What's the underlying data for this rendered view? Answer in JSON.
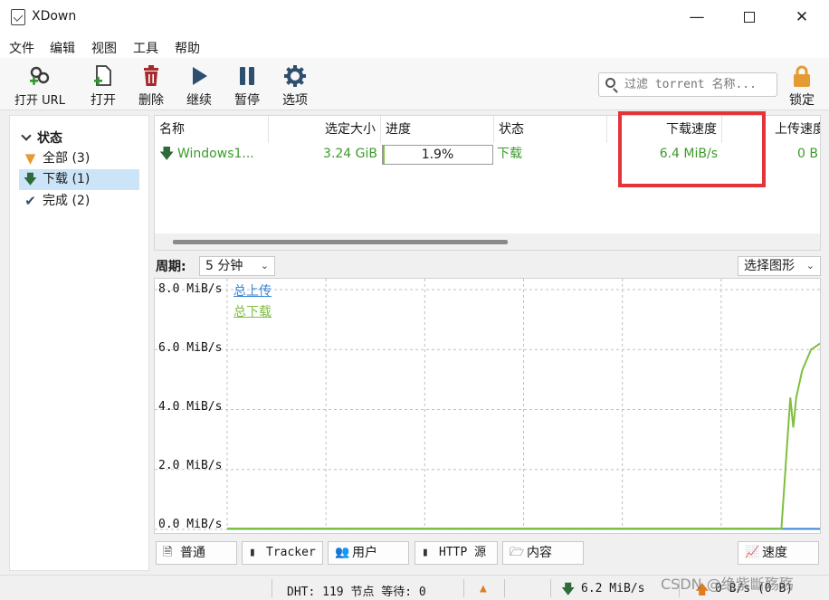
{
  "window": {
    "title": "XDown",
    "minimize_icon": "minimize-icon",
    "maximize_icon": "maximize-icon",
    "close_icon": "close-icon"
  },
  "menu": [
    "文件",
    "编辑",
    "视图",
    "工具",
    "帮助"
  ],
  "toolbar": {
    "open_url": "打开 URL",
    "open": "打开",
    "delete": "删除",
    "resume": "继续",
    "pause": "暂停",
    "options": "选项",
    "filter_placeholder": "过滤 torrent 名称...",
    "lock": "锁定"
  },
  "sidebar": {
    "header": "状态",
    "items": [
      {
        "label": "全部 (3)",
        "icon": "funnel-icon",
        "active": false
      },
      {
        "label": "下载 (1)",
        "icon": "download-arrow-icon",
        "active": true
      },
      {
        "label": "完成 (2)",
        "icon": "checkmark-icon",
        "active": false
      }
    ]
  },
  "list": {
    "columns": [
      "名称",
      "选定大小",
      "进度",
      "状态",
      "下载速度",
      "上传速度"
    ],
    "rows": [
      {
        "name": "Windows1...",
        "size": "3.24 GiB",
        "progress": "1.9%",
        "progress_fraction": 0.019,
        "status": "下载",
        "down_speed": "6.4 MiB/s",
        "up_speed": "0 B"
      }
    ]
  },
  "graph_controls": {
    "period_label": "周期:",
    "period_value": "5 分钟",
    "graph_select": "选择图形"
  },
  "chart_data": {
    "type": "line",
    "ylim": [
      0,
      8
    ],
    "y_unit": "MiB/s",
    "y_ticks": [
      "8.0 MiB/s",
      "6.0 MiB/s",
      "4.0 MiB/s",
      "2.0 MiB/s",
      "0.0 MiB/s"
    ],
    "legend": [
      {
        "name": "总上传",
        "color": "#3a86d8"
      },
      {
        "name": "总下载",
        "color": "#7fbf3f"
      }
    ],
    "grid": true,
    "series": [
      {
        "name": "总上传",
        "points": [
          [
            0,
            0.02
          ],
          [
            0.99,
            0.02
          ],
          [
            1.0,
            0.02
          ]
        ]
      },
      {
        "name": "总下载",
        "points": [
          [
            0,
            0.03
          ],
          [
            0.935,
            0.03
          ],
          [
            0.95,
            4.4
          ],
          [
            0.955,
            3.4
          ],
          [
            0.96,
            4.4
          ],
          [
            0.97,
            5.3
          ],
          [
            0.985,
            6.0
          ],
          [
            1.0,
            6.2
          ]
        ]
      }
    ]
  },
  "tabs": [
    {
      "label": "普通",
      "icon": "info-icon"
    },
    {
      "label": "Tracker",
      "icon": "tracker-icon"
    },
    {
      "label": "用户",
      "icon": "users-icon"
    },
    {
      "label": "HTTP 源",
      "icon": "http-icon"
    },
    {
      "label": "内容",
      "icon": "folder-icon"
    },
    {
      "label": "速度",
      "icon": "speed-chart-icon"
    }
  ],
  "status_bar": {
    "dht": "DHT: 119 节点 等待: 0",
    "down": "6.2 MiB/s",
    "up": "0 B/s (0 B)"
  },
  "watermark": "CSDN @绝紫斷殇殇",
  "colors": {
    "accent_green": "#3b9b2a",
    "highlight_red": "#e5333a",
    "selected_blue": "#cce4f7"
  }
}
